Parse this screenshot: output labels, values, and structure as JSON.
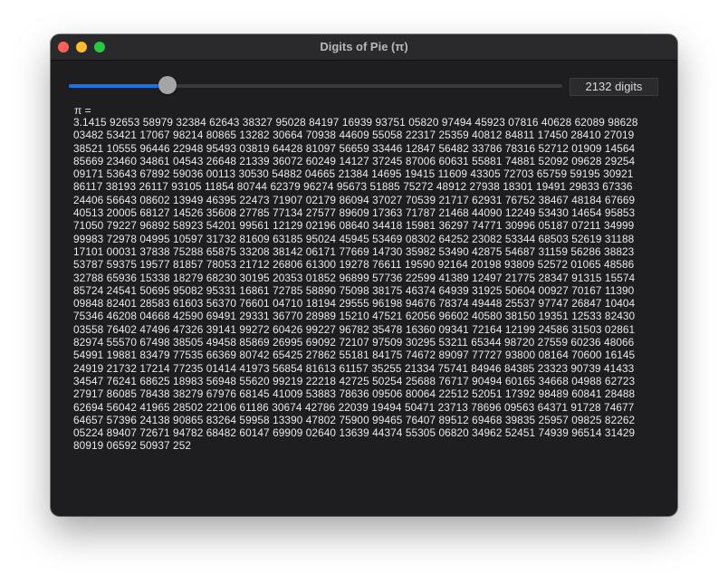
{
  "window": {
    "title": "Digits of Pie (π)"
  },
  "controls": {
    "slider_value_fraction": 0.2,
    "digit_count_label": "2132 digits"
  },
  "content": {
    "pi_label": "π =",
    "digits_text": "3.1415 92653 58979 32384 62643 38327 95028 84197 16939 93751 05820 97494 45923 07816 40628 62089 98628 03482 53421 17067 98214 80865 13282 30664 70938 44609 55058 22317 25359 40812 84811 17450 28410 27019 38521 10555 96446 22948 95493 03819 64428 81097 56659 33446 12847 56482 33786 78316 52712 01909 14564 85669 23460 34861 04543 26648 21339 36072 60249 14127 37245 87006 60631 55881 74881 52092 09628 29254 09171 53643 67892 59036 00113 30530 54882 04665 21384 14695 19415 11609 43305 72703 65759 59195 30921 86117 38193 26117 93105 11854 80744 62379 96274 95673 51885 75272 48912 27938 18301 19491 29833 67336 24406 56643 08602 13949 46395 22473 71907 02179 86094 37027 70539 21717 62931 76752 38467 48184 67669 40513 20005 68127 14526 35608 27785 77134 27577 89609 17363 71787 21468 44090 12249 53430 14654 95853 71050 79227 96892 58923 54201 99561 12129 02196 08640 34418 15981 36297 74771 30996 05187 07211 34999 99983 72978 04995 10597 31732 81609 63185 95024 45945 53469 08302 64252 23082 53344 68503 52619 31188 17101 00031 37838 75288 65875 33208 38142 06171 77669 14730 35982 53490 42875 54687 31159 56286 38823 53787 59375 19577 81857 78053 21712 26806 61300 19278 76611 19590 92164 20198 93809 52572 01065 48586 32788 65936 15338 18279 68230 30195 20353 01852 96899 57736 22599 41389 12497 21775 28347 91315 15574 85724 24541 50695 95082 95331 16861 72785 58890 75098 38175 46374 64939 31925 50604 00927 70167 11390 09848 82401 28583 61603 56370 76601 04710 18194 29555 96198 94676 78374 49448 25537 97747 26847 10404 75346 46208 04668 42590 69491 29331 36770 28989 15210 47521 62056 96602 40580 38150 19351 12533 82430 03558 76402 47496 47326 39141 99272 60426 99227 96782 35478 16360 09341 72164 12199 24586 31503 02861 82974 55570 67498 38505 49458 85869 26995 69092 72107 97509 30295 53211 65344 98720 27559 60236 48066 54991 19881 83479 77535 66369 80742 65425 27862 55181 84175 74672 89097 77727 93800 08164 70600 16145 24919 21732 17214 77235 01414 41973 56854 81613 61157 35255 21334 75741 84946 84385 23323 90739 41433 34547 76241 68625 18983 56948 55620 99219 22218 42725 50254 25688 76717 90494 60165 34668 04988 62723 27917 86085 78438 38279 67976 68145 41009 53883 78636 09506 80064 22512 52051 17392 98489 60841 28488 62694 56042 41965 28502 22106 61186 30674 42786 22039 19494 50471 23713 78696 09563 64371 91728 74677 64657 57396 24138 90865 83264 59958 13390 47802 75900 99465 76407 89512 69468 39835 25957 09825 82262 05224 89407 72671 94782 68482 60147 69909 02640 13639 44374 55305 06820 34962 52451 74939 96514 31429 80919 06592 50937 252"
  }
}
